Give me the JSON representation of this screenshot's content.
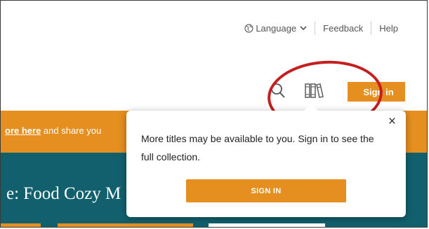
{
  "utility_bar": {
    "language_label": "Language",
    "feedback_label": "Feedback",
    "help_label": "Help"
  },
  "header": {
    "signin_label": "Sign in"
  },
  "promo": {
    "link_text": "ore here",
    "rest_text": " and share you"
  },
  "hero": {
    "title": "e: Food Cozy M"
  },
  "popover": {
    "message": "More titles may be available to you. Sign in to see the full collection.",
    "close_glyph": "×",
    "signin_label": "SIGN IN"
  },
  "colors": {
    "accent_orange": "#e48f1f",
    "hero_teal": "#12606e",
    "highlight_red": "#c41e1e"
  },
  "icons": [
    "globe-icon",
    "chevron-down-icon",
    "search-icon",
    "bookshelf-icon",
    "close-icon"
  ]
}
